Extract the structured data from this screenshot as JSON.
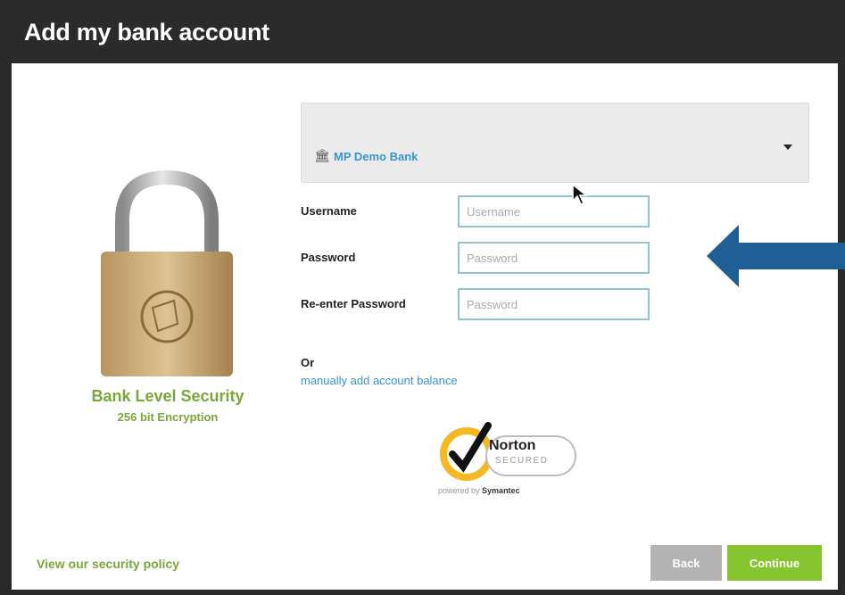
{
  "header": {
    "title": "Add my bank account"
  },
  "security": {
    "title": "Bank Level Security",
    "subtitle": "256 bit Encryption",
    "icon": "padlock-icon"
  },
  "bank": {
    "selected": "MP Demo Bank",
    "icon": "bank-icon"
  },
  "form": {
    "username_label": "Username",
    "username_placeholder": "Username",
    "password_label": "Password",
    "password_placeholder": "Password",
    "reenter_label": "Re-enter Password",
    "reenter_placeholder": "Password"
  },
  "alt": {
    "or": "Or",
    "manual_link": "manually add account balance"
  },
  "norton": {
    "brand": "Norton",
    "secured": "SECURED",
    "powered_prefix": "powered by",
    "powered_brand": "Symantec"
  },
  "footer": {
    "policy_link": "View our security policy",
    "back_label": "Back",
    "continue_label": "Continue"
  },
  "colors": {
    "accent_green": "#86c52f",
    "link_blue": "#3a95c9",
    "header_bg": "#2b2b2b",
    "arrow_blue": "#1f5f96"
  }
}
